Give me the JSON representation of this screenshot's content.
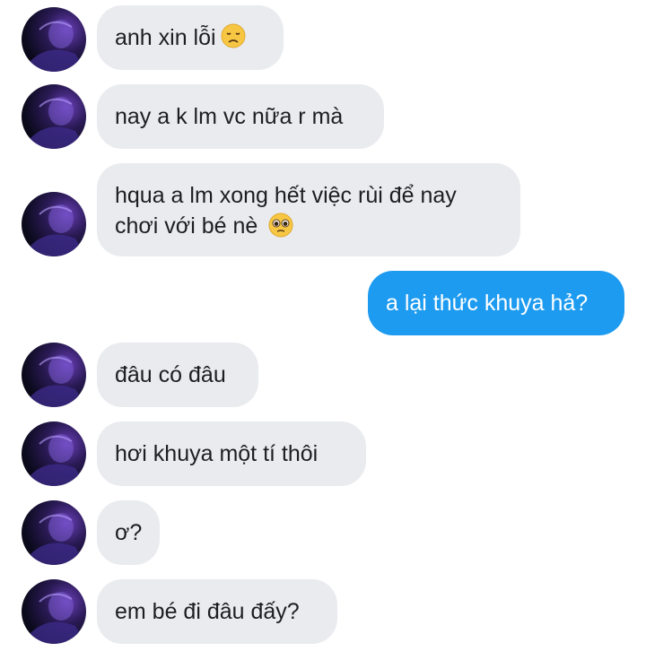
{
  "conversation": {
    "messages": [
      {
        "direction": "in",
        "text": "anh xin lỗi",
        "emoji": "disappointed-face"
      },
      {
        "direction": "in",
        "text": "nay a k lm vc nữa r mà"
      },
      {
        "direction": "in",
        "text": "hqua a lm xong hết việc rùi để nay",
        "text2": "chơi với bé nè",
        "emoji": "pleading-face"
      },
      {
        "direction": "out",
        "text": "a lại thức khuya hả?"
      },
      {
        "direction": "in",
        "text": "đâu có đâu"
      },
      {
        "direction": "in",
        "text": "hơi khuya một tí thôi"
      },
      {
        "direction": "in",
        "text": "ơ?"
      },
      {
        "direction": "in",
        "text": "em bé đi đâu đấy?"
      }
    ]
  },
  "colors": {
    "incoming_bubble": "#e9ebee",
    "outgoing_bubble": "#1d9bf0",
    "incoming_text": "#1c1e21",
    "outgoing_text": "#ffffff",
    "background": "#ffffff"
  }
}
